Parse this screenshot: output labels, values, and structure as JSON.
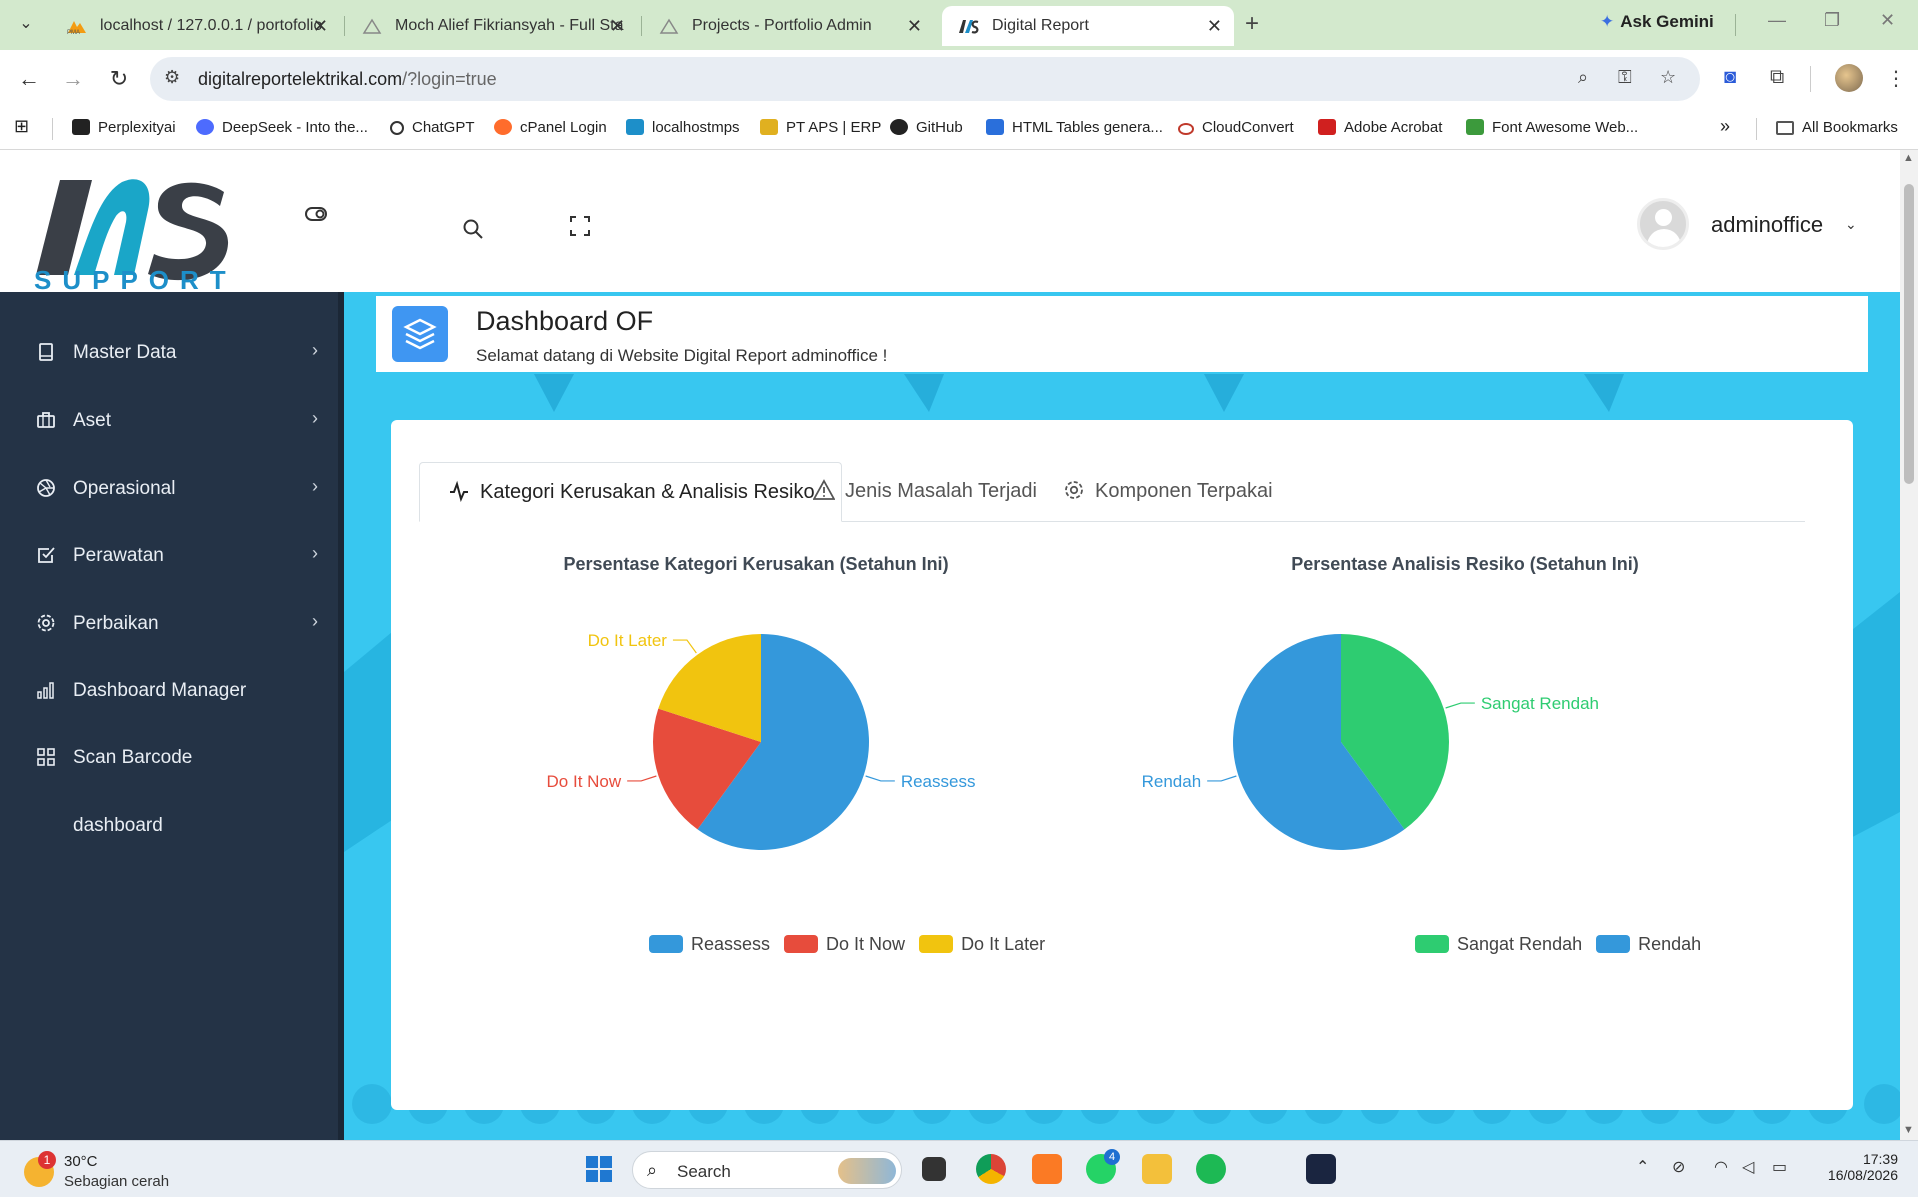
{
  "browser": {
    "tabs": [
      {
        "title": "localhost / 127.0.0.1 / portofolio"
      },
      {
        "title": "Moch Alief Fikriansyah - Full Sta"
      },
      {
        "title": "Projects - Portfolio Admin"
      },
      {
        "title": "Digital Report"
      }
    ],
    "gemini_label": "Ask Gemini",
    "url_host": "digitalreportelektrikal.com",
    "url_path": "/?login=true",
    "bookmarks": [
      "Perplexityai",
      "DeepSeek - Into the...",
      "ChatGPT",
      "cPanel Login",
      "localhostmps",
      "PT APS | ERP",
      "GitHub",
      "HTML Tables genera...",
      "CloudConvert",
      "Adobe Acrobat",
      "Font Awesome Web..."
    ],
    "all_bookmarks": "All Bookmarks"
  },
  "app": {
    "logo_text": "SUPPORT",
    "username": "adminoffice",
    "sidebar": [
      {
        "label": "Master Data",
        "icon": "book-icon",
        "has_children": true
      },
      {
        "label": "Aset",
        "icon": "briefcase-icon",
        "has_children": true
      },
      {
        "label": "Operasional",
        "icon": "aperture-icon",
        "has_children": true
      },
      {
        "label": "Perawatan",
        "icon": "check-square-icon",
        "has_children": true
      },
      {
        "label": "Perbaikan",
        "icon": "gear-icon",
        "has_children": true
      },
      {
        "label": "Dashboard Manager",
        "icon": "bar-chart-icon",
        "has_children": false
      },
      {
        "label": "Scan Barcode",
        "icon": "grid-icon",
        "has_children": false
      },
      {
        "label": "dashboard",
        "icon": "",
        "has_children": false
      }
    ],
    "banner": {
      "title": "Dashboard OF",
      "subtitle": "Selamat datang di Website Digital Report adminoffice !"
    },
    "tabs": [
      {
        "label": "Kategori Kerusakan & Analisis Resiko",
        "icon": "activity-icon",
        "active": true
      },
      {
        "label": "Jenis Masalah Terjadi",
        "icon": "alert-triangle-icon",
        "active": false
      },
      {
        "label": "Komponen Terpakai",
        "icon": "gear-icon",
        "active": false
      }
    ]
  },
  "chart_data": [
    {
      "type": "pie",
      "title": "Persentase Kategori Kerusakan (Setahun Ini)",
      "categories": [
        "Reassess",
        "Do It Now",
        "Do It Later"
      ],
      "values": [
        60,
        20,
        20
      ],
      "colors": [
        "#3498db",
        "#e74c3c",
        "#f1c40f"
      ],
      "legend": "bottom"
    },
    {
      "type": "pie",
      "title": "Persentase Analisis Resiko (Setahun Ini)",
      "categories": [
        "Sangat Rendah",
        "Rendah"
      ],
      "values": [
        40,
        60
      ],
      "colors": [
        "#2ecc71",
        "#3498db"
      ],
      "legend": "bottom"
    }
  ],
  "taskbar": {
    "weather_temp": "30°C",
    "weather_cond": "Sebagian cerah",
    "weather_badge": "1",
    "search_label": "Search",
    "whatsapp_badge": "4",
    "time": "17:39",
    "date": "16/08/2026"
  }
}
